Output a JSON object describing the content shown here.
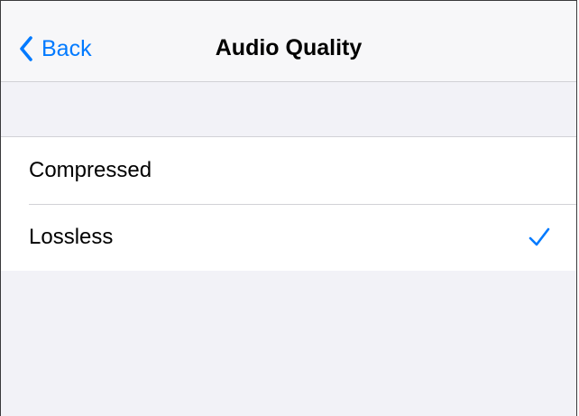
{
  "navbar": {
    "back_label": "Back",
    "title": "Audio Quality"
  },
  "options": [
    {
      "label": "Compressed",
      "selected": false
    },
    {
      "label": "Lossless",
      "selected": true
    }
  ],
  "icons": {
    "back": "chevron-left-icon",
    "selected": "checkmark-icon"
  },
  "colors": {
    "accent": "#007aff",
    "background": "#f2f2f7",
    "separator": "#d1d1d6"
  }
}
